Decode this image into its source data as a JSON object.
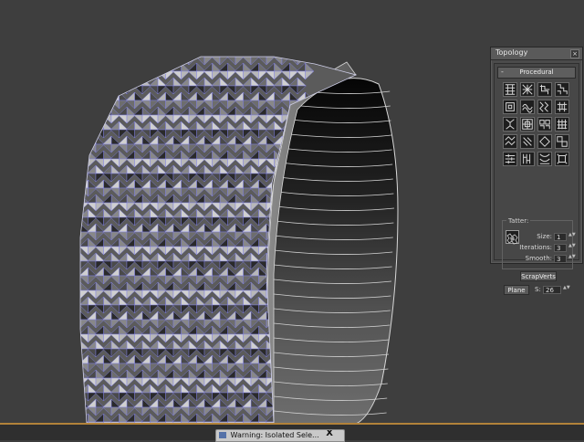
{
  "panel": {
    "title": "Topology",
    "close_glyph": "×",
    "rollout_toggle": "-",
    "rollout_label": "Procedural",
    "tile_icon": "topology-pattern-icon",
    "tatter": {
      "group_label": "Tatter:",
      "size_label": "Size:",
      "size_value": "1",
      "iterations_label": "Iterations:",
      "iterations_value": "3",
      "smooth_label": "Smooth:",
      "smooth_value": "3"
    },
    "scrapverts_label": "ScrapVerts",
    "plane_label": "Plane",
    "s_label": "S:",
    "s_value": "26",
    "spinner_glyph": "▲▼"
  },
  "bottom": {
    "isolate_title": "Warning: Isolated Sele...",
    "isolate_close": "X",
    "accent_color": "#b2823a"
  },
  "viewport": {
    "background": "#3e3e3e",
    "wire_color": "#7f7fe6",
    "object": "textured ring mesh"
  }
}
